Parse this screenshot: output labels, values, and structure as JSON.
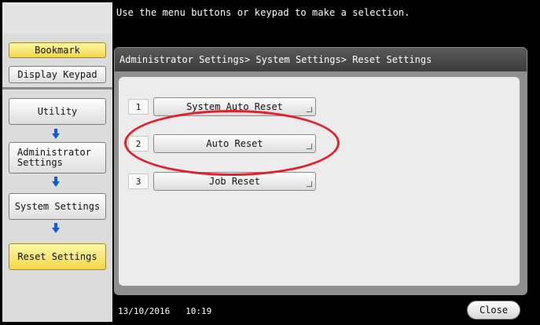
{
  "header": {
    "message": "Use the menu buttons or keypad to make a selection."
  },
  "left_panel": {
    "bookmark_label": "Bookmark",
    "display_keypad_label": "Display Keypad",
    "nav": [
      {
        "label": "Utility"
      },
      {
        "label": "Administrator\nSettings"
      },
      {
        "label": "System Settings"
      },
      {
        "label": "Reset Settings"
      }
    ]
  },
  "breadcrumb": "Administrator Settings> System Settings> Reset Settings",
  "items": [
    {
      "number": "1",
      "label": "System Auto Reset"
    },
    {
      "number": "2",
      "label": "Auto Reset"
    },
    {
      "number": "3",
      "label": "Job Reset"
    }
  ],
  "footer": {
    "date": "13/10/2016",
    "time": "10:19",
    "close_label": "Close"
  },
  "colors": {
    "highlight_yellow": "#f2d64a",
    "annotation_red": "#e3202a",
    "arrow_blue": "#1558d6"
  }
}
